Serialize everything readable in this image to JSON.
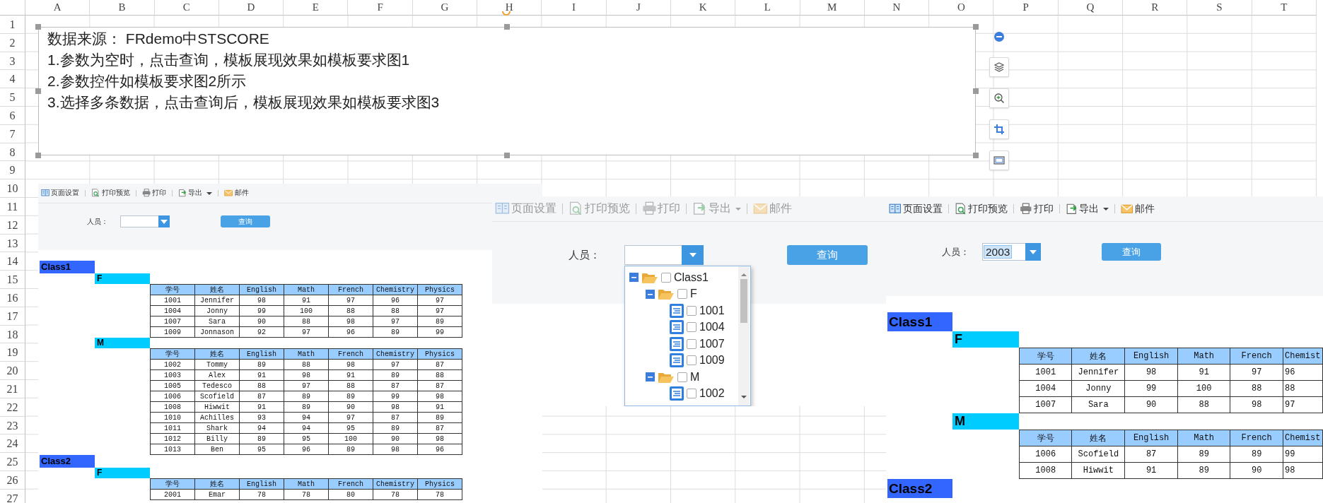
{
  "sheet": {
    "columns": [
      "A",
      "B",
      "C",
      "D",
      "E",
      "F",
      "G",
      "H",
      "I",
      "J",
      "K",
      "L",
      "M",
      "N",
      "O",
      "P",
      "Q",
      "R",
      "S",
      "T"
    ],
    "rows": [
      "1",
      "2",
      "3",
      "4",
      "5",
      "6",
      "7",
      "8",
      "9",
      "10",
      "11",
      "12",
      "13",
      "14",
      "15",
      "16",
      "17",
      "18",
      "19",
      "20",
      "21",
      "22",
      "23",
      "24",
      "25",
      "26",
      "27"
    ]
  },
  "text_box": {
    "lines": [
      "数据来源： FRdemo中STSCORE",
      "1.参数为空时，点击查询，模板展现效果如模板要求图1",
      "2.参数控件如模板要求图2所示",
      "3.选择多条数据，点击查询后，模板展现效果如模板要求图3"
    ]
  },
  "screenshots": [
    {
      "kind": "report",
      "toolbar_disabled": false,
      "toolbar": [
        {
          "kind": "page_setup",
          "label": "页面设置"
        },
        {
          "kind": "print_preview",
          "label": "打印预览"
        },
        {
          "kind": "print",
          "label": "打印"
        },
        {
          "kind": "export",
          "label": "导出"
        },
        {
          "kind": "mail",
          "label": "邮件"
        }
      ],
      "parameter": {
        "label": "人员：",
        "button": "查询"
      },
      "groups": [
        {
          "name": "Class1",
          "sections": [
            {
              "name": "F",
              "columns": [
                "学号",
                "姓名",
                "English",
                "Math",
                "French",
                "Chemistry",
                "Physics"
              ],
              "rows": [
                [
                  "1001",
                  "Jennifer",
                  "98",
                  "91",
                  "97",
                  "96",
                  "97"
                ],
                [
                  "1004",
                  "Jonny",
                  "99",
                  "100",
                  "88",
                  "88",
                  "97"
                ],
                [
                  "1007",
                  "Sara",
                  "90",
                  "88",
                  "98",
                  "97",
                  "89"
                ],
                [
                  "1009",
                  "Jonnason",
                  "92",
                  "97",
                  "96",
                  "89",
                  "99"
                ]
              ]
            },
            {
              "name": "M",
              "columns": [
                "学号",
                "姓名",
                "English",
                "Math",
                "French",
                "Chemistry",
                "Physics"
              ],
              "rows": [
                [
                  "1002",
                  "Tommy",
                  "89",
                  "88",
                  "98",
                  "97",
                  "87"
                ],
                [
                  "1003",
                  "Alex",
                  "91",
                  "98",
                  "91",
                  "89",
                  "88"
                ],
                [
                  "1005",
                  "Tedesco",
                  "88",
                  "97",
                  "88",
                  "87",
                  "87"
                ],
                [
                  "1006",
                  "Scofield",
                  "87",
                  "89",
                  "89",
                  "99",
                  "98"
                ],
                [
                  "1008",
                  "Hiwwit",
                  "91",
                  "89",
                  "90",
                  "98",
                  "91"
                ],
                [
                  "1010",
                  "Achilles",
                  "93",
                  "94",
                  "97",
                  "87",
                  "89"
                ],
                [
                  "1011",
                  "Shark",
                  "94",
                  "94",
                  "95",
                  "89",
                  "87"
                ],
                [
                  "1012",
                  "Billy",
                  "89",
                  "95",
                  "100",
                  "90",
                  "98"
                ],
                [
                  "1013",
                  "Ben",
                  "95",
                  "96",
                  "89",
                  "98",
                  "96"
                ]
              ]
            }
          ]
        },
        {
          "name": "Class2",
          "sections": [
            {
              "name": "F",
              "columns": [
                "学号",
                "姓名",
                "English",
                "Math",
                "French",
                "Chemistry",
                "Physics"
              ],
              "rows": [
                [
                  "2001",
                  "Emar",
                  "78",
                  "78",
                  "80",
                  "78",
                  "78"
                ]
              ]
            }
          ]
        }
      ]
    },
    {
      "kind": "dropdown",
      "toolbar_disabled": true,
      "toolbar": [
        {
          "kind": "page_setup",
          "label": "页面设置"
        },
        {
          "kind": "print_preview",
          "label": "打印预览"
        },
        {
          "kind": "print",
          "label": "打印"
        },
        {
          "kind": "export",
          "label": "导出"
        },
        {
          "kind": "mail",
          "label": "邮件"
        }
      ],
      "parameter": {
        "label": "人员：",
        "button": "查询"
      },
      "tree": [
        {
          "label": "Class1",
          "expanded": true,
          "checked": false,
          "children": [
            {
              "label": "F",
              "expanded": true,
              "checked": false,
              "children": [
                {
                  "label": "1001",
                  "checked": false
                },
                {
                  "label": "1004",
                  "checked": false
                },
                {
                  "label": "1007",
                  "checked": false
                },
                {
                  "label": "1009",
                  "checked": false
                }
              ]
            },
            {
              "label": "M",
              "expanded": true,
              "checked": false,
              "children": [
                {
                  "label": "1002",
                  "checked": false
                }
              ]
            }
          ]
        }
      ]
    },
    {
      "kind": "report",
      "toolbar_disabled": false,
      "toolbar": [
        {
          "kind": "page_setup",
          "label": "页面设置"
        },
        {
          "kind": "print_preview",
          "label": "打印预览"
        },
        {
          "kind": "print",
          "label": "打印"
        },
        {
          "kind": "export",
          "label": "导出"
        },
        {
          "kind": "mail",
          "label": "邮件"
        }
      ],
      "parameter": {
        "label": "人员：",
        "value": "2003",
        "value_highlighted": true,
        "button": "查询"
      },
      "groups": [
        {
          "name": "Class1",
          "sections": [
            {
              "name": "F",
              "columns": [
                "学号",
                "姓名",
                "English",
                "Math",
                "French",
                "Chemist"
              ],
              "rows": [
                [
                  "1001",
                  "Jennifer",
                  "98",
                  "91",
                  "97",
                  "96"
                ],
                [
                  "1004",
                  "Jonny",
                  "99",
                  "100",
                  "88",
                  "88"
                ],
                [
                  "1007",
                  "Sara",
                  "90",
                  "88",
                  "98",
                  "97"
                ]
              ]
            },
            {
              "name": "M",
              "columns": [
                "学号",
                "姓名",
                "English",
                "Math",
                "French",
                "Chemist"
              ],
              "rows": [
                [
                  "1006",
                  "Scofield",
                  "87",
                  "89",
                  "89",
                  "99"
                ],
                [
                  "1008",
                  "Hiwwit",
                  "91",
                  "89",
                  "90",
                  "98"
                ]
              ]
            }
          ]
        },
        {
          "name": "Class2"
        }
      ]
    }
  ]
}
